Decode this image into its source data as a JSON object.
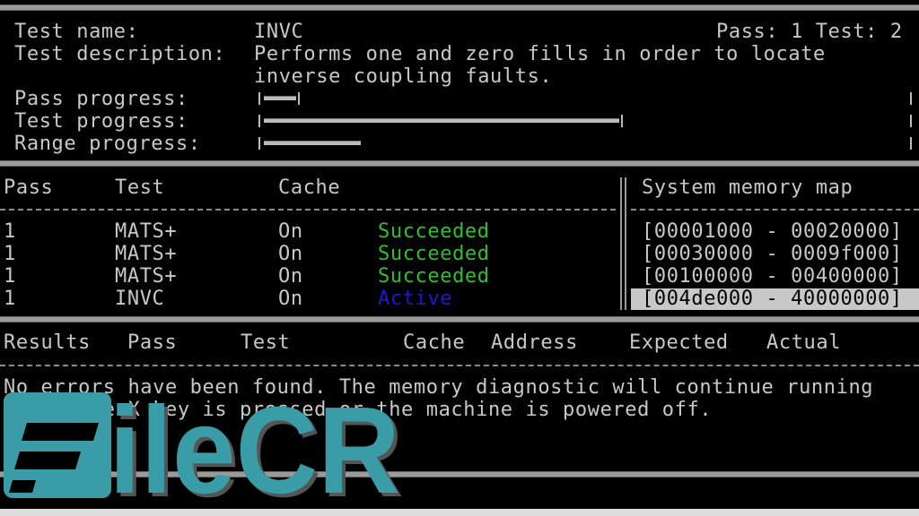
{
  "header": {
    "test_name_label": "Test name:",
    "test_name": "INVC",
    "pass_test_status": "Pass: 1 Test: 2",
    "test_description_label": "Test description:",
    "test_description_line1": "Performs one and zero fills in order to locate",
    "test_description_line2": "inverse coupling faults.",
    "pass_progress_label": "Pass progress:",
    "test_progress_label": "Test progress:",
    "range_progress_label": "Range progress:",
    "pass_progress_percent": 5,
    "test_progress_percent": 55,
    "range_progress_percent": 15
  },
  "pass_table": {
    "columns": [
      "Pass",
      "Test",
      "Cache"
    ],
    "rows": [
      {
        "pass": "1",
        "test": "MATS+",
        "cache": "On",
        "status": "Succeeded"
      },
      {
        "pass": "1",
        "test": "MATS+",
        "cache": "On",
        "status": "Succeeded"
      },
      {
        "pass": "1",
        "test": "MATS+",
        "cache": "On",
        "status": "Succeeded"
      },
      {
        "pass": "1",
        "test": "INVC",
        "cache": "On",
        "status": "Active"
      }
    ]
  },
  "memory_map": {
    "title": "System memory map",
    "ranges": [
      "[00001000 - 00020000]",
      "[00030000 - 0009f000]",
      "[00100000 - 00400000]",
      "[004de000 - 40000000]"
    ]
  },
  "results": {
    "columns": [
      "Results",
      "Pass",
      "Test",
      "Cache",
      "Address",
      "Expected",
      "Actual"
    ],
    "message_line1": "No errors have been found. The memory diagnostic will continue running",
    "message_line2": "until the X key is pressed or the machine is powered off."
  },
  "watermark": {
    "text": "FileCR",
    "color": "#3a9ca6"
  },
  "colors": {
    "success": "#2fbf2f",
    "active": "#1a1ad0",
    "text": "#c8c8c8",
    "background": "#000000"
  }
}
